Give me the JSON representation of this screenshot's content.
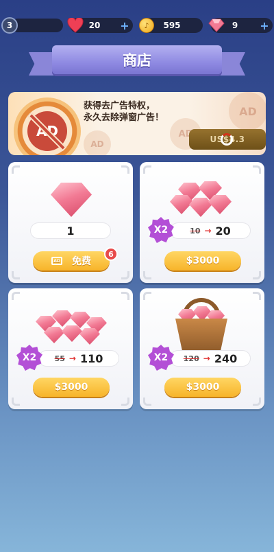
{
  "topbar": {
    "level": "3",
    "hearts": {
      "value": "20",
      "icon": "heart-icon",
      "plus": "+"
    },
    "coins": {
      "value": "595",
      "icon": "coin-icon",
      "plus": "+"
    },
    "gems": {
      "value": "9",
      "icon": "gem-icon",
      "plus": "+"
    }
  },
  "title": "商店",
  "ad_banner": {
    "line1": "获得去广告特权，",
    "line2": "永久去除弹窗广告！",
    "badge_text": "AD",
    "price_label": "US$4.3",
    "deco_text": "AD"
  },
  "items": [
    {
      "amount": "1",
      "button_label": "免费",
      "badge_count": "6",
      "button_icon": "ad-video-icon"
    },
    {
      "multiplier": "X2",
      "old_amount": "10",
      "arrow": "→",
      "amount": "20",
      "button_label": "$3000"
    },
    {
      "multiplier": "X2",
      "old_amount": "55",
      "arrow": "→",
      "amount": "110",
      "button_label": "$3000"
    },
    {
      "multiplier": "X2",
      "old_amount": "120",
      "arrow": "→",
      "amount": "240",
      "button_label": "$3000"
    }
  ],
  "colors": {
    "accent_gold": "#f7b42a",
    "ribbon_purple": "#8f8ae2",
    "gem_pink": "#f27a94",
    "badge_red": "#e84a4a"
  }
}
